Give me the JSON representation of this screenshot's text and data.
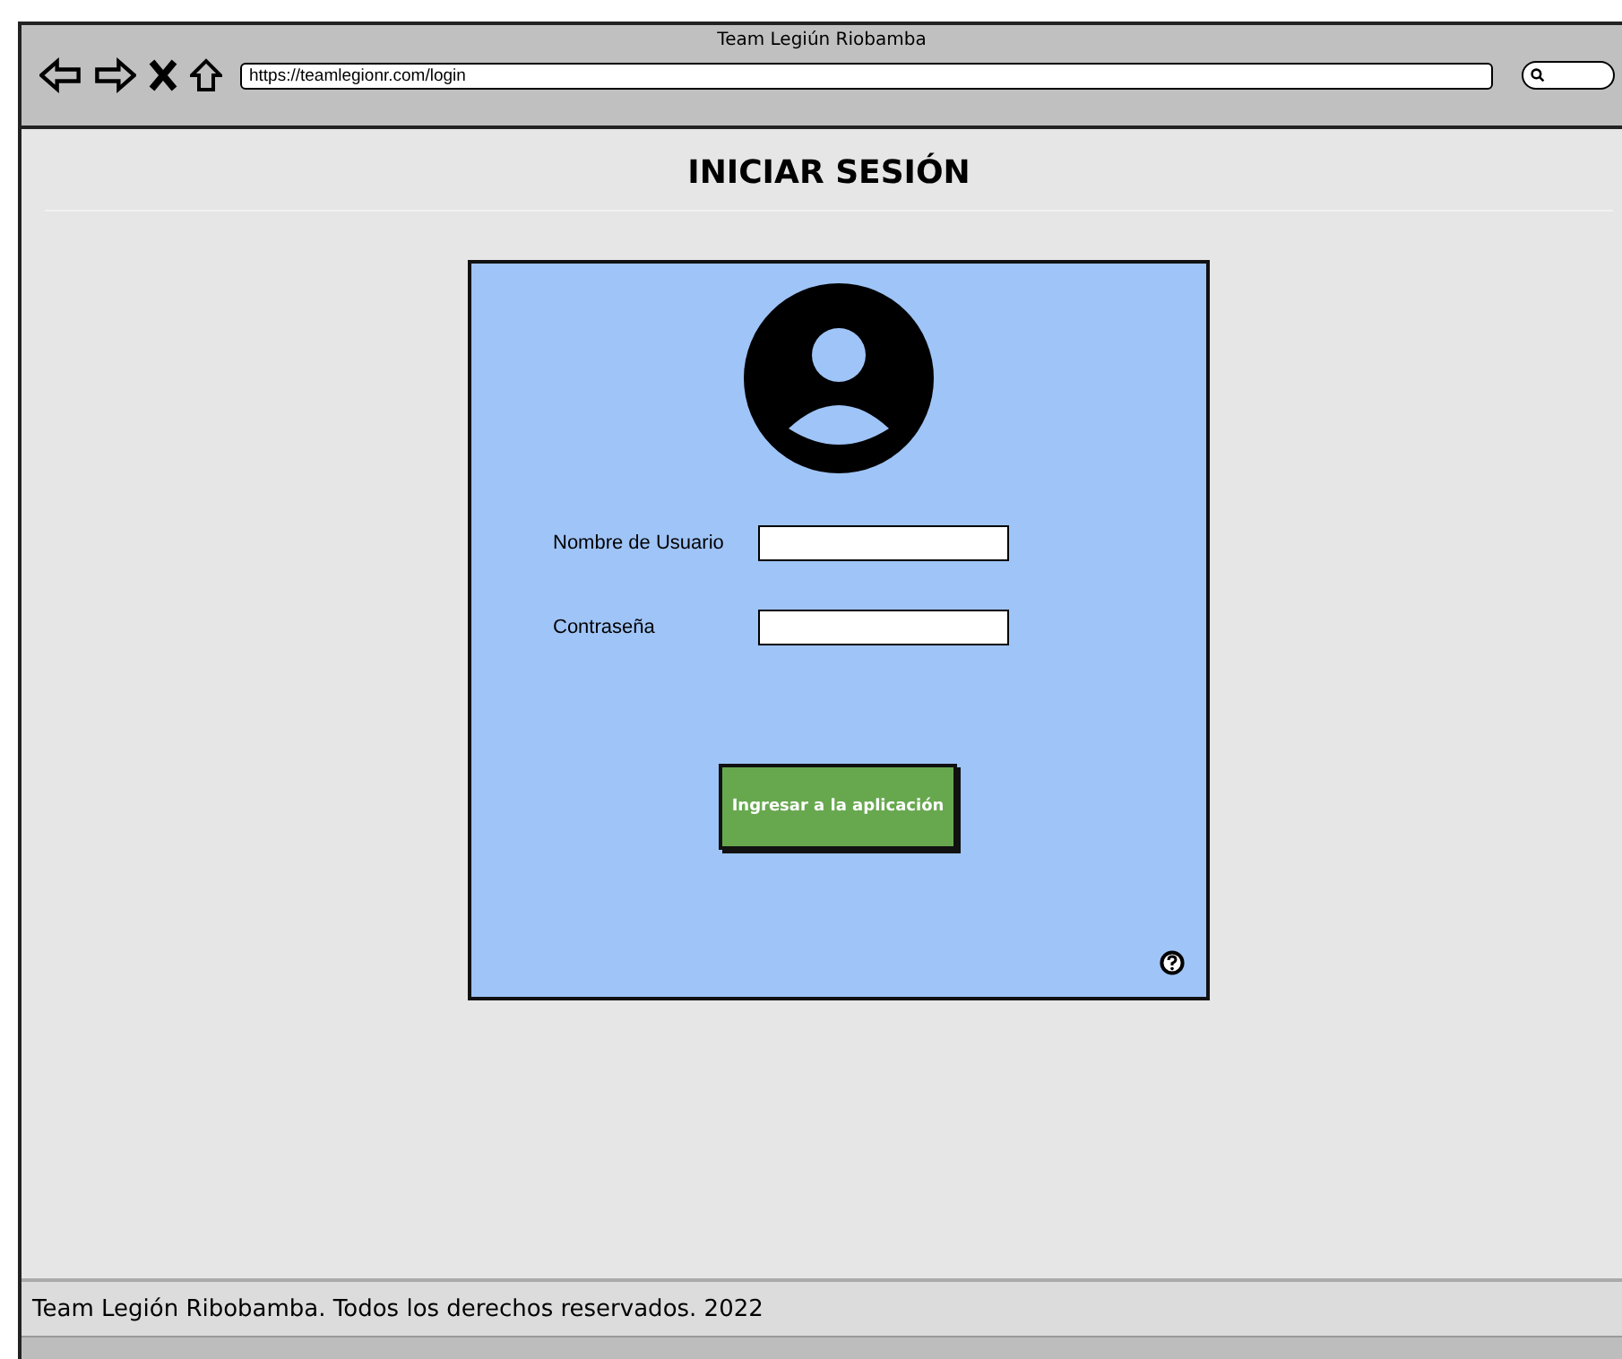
{
  "window": {
    "title": "Team Legiún Riobamba",
    "url": "https://teamlegionr.com/login"
  },
  "heading": "INICIAR SESIÓN",
  "form": {
    "fields": [
      {
        "label": "Nombre de Usuario"
      },
      {
        "label": "Contraseña"
      }
    ],
    "submit": "Ingresar a la aplicación"
  },
  "footer": "Team Legión Ribobamba. Todos los derechos reservados. 2022"
}
